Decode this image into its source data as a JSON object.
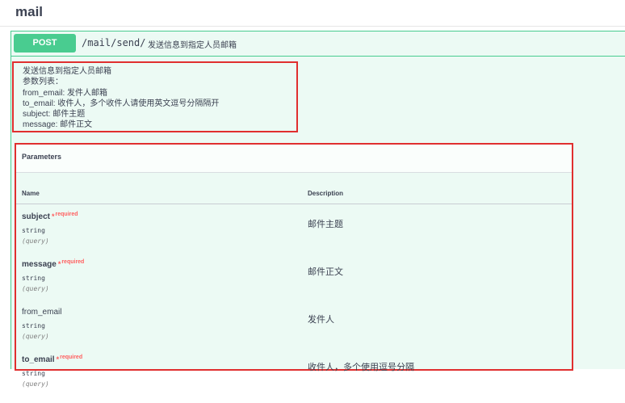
{
  "section": {
    "title": "mail"
  },
  "operation": {
    "method": "POST",
    "path": "/mail/send/",
    "summary": "发送信息到指定人员邮箱",
    "description_lines": [
      "发送信息到指定人员邮箱",
      "参数列表：",
      "from_email:  发件人邮箱",
      "to_email: 收件人，多个收件人请使用英文逗号分隔隔开",
      "subject: 邮件主题",
      "message: 邮件正文"
    ]
  },
  "parameters": {
    "title": "Parameters",
    "col_name": "Name",
    "col_description": "Description",
    "items": [
      {
        "name": "subject",
        "required": true,
        "star": "*",
        "required_label": "required",
        "type": "string",
        "in": "(query)",
        "description": "邮件主题"
      },
      {
        "name": "message",
        "required": true,
        "star": "*",
        "required_label": "required",
        "type": "string",
        "in": "(query)",
        "description": "邮件正文"
      },
      {
        "name": "from_email",
        "required": false,
        "type": "string",
        "in": "(query)",
        "description": "发件人"
      },
      {
        "name": "to_email",
        "required": true,
        "star": "*",
        "required_label": "required",
        "type": "string",
        "in": "(query)",
        "description": "收件人，多个使用逗号分隔"
      }
    ]
  },
  "colors": {
    "post_green": "#49cc90",
    "annotation_red": "#e02f2f",
    "required_red": "#ff6060"
  }
}
